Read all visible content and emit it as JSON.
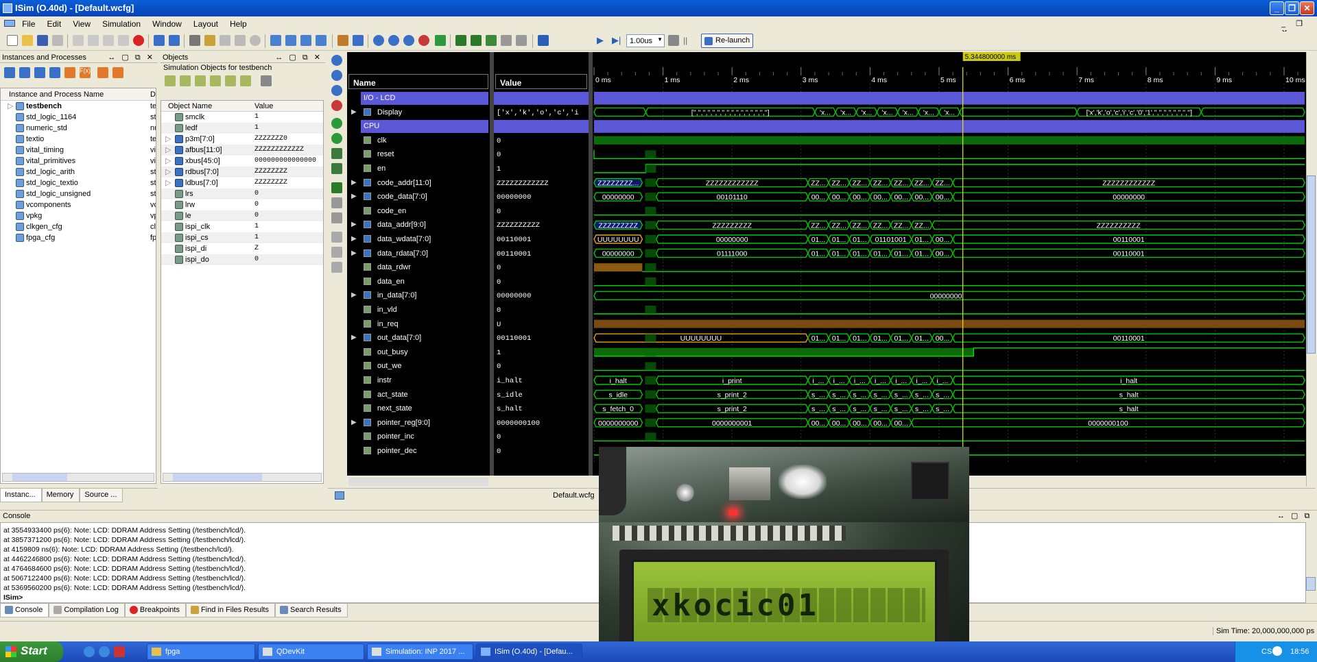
{
  "window": {
    "title": "ISim (O.40d) - [Default.wcfg]"
  },
  "menu": [
    "File",
    "Edit",
    "View",
    "Simulation",
    "Window",
    "Layout",
    "Help"
  ],
  "toolbar": {
    "sim_time": "1.00us",
    "relaunch_label": "Re-launch"
  },
  "instances_panel": {
    "title": "Instances and Processes",
    "col_name": "Instance and Process Name",
    "col_design": "D",
    "items": [
      {
        "name": "testbench",
        "d": "te",
        "bold": true
      },
      {
        "name": "std_logic_1164",
        "d": "st"
      },
      {
        "name": "numeric_std",
        "d": "nu"
      },
      {
        "name": "textio",
        "d": "te"
      },
      {
        "name": "vital_timing",
        "d": "vi"
      },
      {
        "name": "vital_primitives",
        "d": "vi"
      },
      {
        "name": "std_logic_arith",
        "d": "st"
      },
      {
        "name": "std_logic_textio",
        "d": "st"
      },
      {
        "name": "std_logic_unsigned",
        "d": "st"
      },
      {
        "name": "vcomponents",
        "d": "vc"
      },
      {
        "name": "vpkg",
        "d": "vp"
      },
      {
        "name": "clkgen_cfg",
        "d": "cll"
      },
      {
        "name": "fpga_cfg",
        "d": "fp"
      }
    ],
    "tabs": [
      "Instanc...",
      "Memory",
      "Source ..."
    ]
  },
  "objects_panel": {
    "title": "Objects",
    "subtitle": "Simulation Objects for testbench",
    "col_name": "Object Name",
    "col_value": "Value",
    "items": [
      {
        "name": "smclk",
        "value": "1",
        "bus": false
      },
      {
        "name": "ledf",
        "value": "1",
        "bus": false
      },
      {
        "name": "p3m[7:0]",
        "value": "ZZZZZZZ0",
        "bus": true
      },
      {
        "name": "afbus[11:0]",
        "value": "ZZZZZZZZZZZZ",
        "bus": true
      },
      {
        "name": "xbus[45:0]",
        "value": "000000000000000",
        "bus": true
      },
      {
        "name": "rdbus[7:0]",
        "value": "ZZZZZZZZ",
        "bus": true
      },
      {
        "name": "ldbus[7:0]",
        "value": "ZZZZZZZZ",
        "bus": true
      },
      {
        "name": "lrs",
        "value": "0",
        "bus": false
      },
      {
        "name": "lrw",
        "value": "0",
        "bus": false
      },
      {
        "name": "le",
        "value": "0",
        "bus": false
      },
      {
        "name": "ispi_clk",
        "value": "1",
        "bus": false
      },
      {
        "name": "ispi_cs",
        "value": "1",
        "bus": false
      },
      {
        "name": "ispi_di",
        "value": "Z",
        "bus": false
      },
      {
        "name": "ispi_do",
        "value": "0",
        "bus": false
      }
    ]
  },
  "wave": {
    "name_header": "Name",
    "value_header": "Value",
    "cursor_label": "5.344800000 ms",
    "time_ticks": [
      "0 ms",
      "1 ms",
      "2 ms",
      "3 ms",
      "4 ms",
      "5 ms",
      "6 ms",
      "7 ms",
      "8 ms",
      "9 ms",
      "10 ms"
    ],
    "signals": [
      {
        "name": "I/O - LCD",
        "value": "",
        "group": true
      },
      {
        "name": "Display",
        "value": "['x','k','o','c','i",
        "bus": true
      },
      {
        "name": "CPU",
        "value": "",
        "group": true
      },
      {
        "name": "clk",
        "value": "0"
      },
      {
        "name": "reset",
        "value": "0"
      },
      {
        "name": "en",
        "value": "1"
      },
      {
        "name": "code_addr[11:0]",
        "value": "ZZZZZZZZZZZZ",
        "bus": true
      },
      {
        "name": "code_data[7:0]",
        "value": "00000000",
        "bus": true
      },
      {
        "name": "code_en",
        "value": "0"
      },
      {
        "name": "data_addr[9:0]",
        "value": "ZZZZZZZZZZ",
        "bus": true
      },
      {
        "name": "data_wdata[7:0]",
        "value": "00110001",
        "bus": true
      },
      {
        "name": "data_rdata[7:0]",
        "value": "00110001",
        "bus": true
      },
      {
        "name": "data_rdwr",
        "value": "0"
      },
      {
        "name": "data_en",
        "value": "0"
      },
      {
        "name": "in_data[7:0]",
        "value": "00000000",
        "bus": true
      },
      {
        "name": "in_vld",
        "value": "0"
      },
      {
        "name": "in_req",
        "value": "U"
      },
      {
        "name": "out_data[7:0]",
        "value": "00110001",
        "bus": true
      },
      {
        "name": "out_busy",
        "value": "1"
      },
      {
        "name": "out_we",
        "value": "0"
      },
      {
        "name": "instr",
        "value": "i_halt"
      },
      {
        "name": "act_state",
        "value": "s_idle"
      },
      {
        "name": "next_state",
        "value": "s_halt"
      },
      {
        "name": "pointer_reg[9:0]",
        "value": "0000000100",
        "bus": true
      },
      {
        "name": "pointer_inc",
        "value": "0"
      },
      {
        "name": "pointer_dec",
        "value": "0"
      }
    ],
    "labels": {
      "display_a": "['','','','','','','','','','','','','','','','']",
      "display_b": "['x','k','o','c','i','c','0','1','','','','','','','','']",
      "code_addr_a": "ZZZZZZZZ...",
      "code_addr_b": "ZZZZZZZZZZZZ",
      "code_data_a": "00000000",
      "code_data_b": "00101110",
      "data_addr_a": "ZZZZZZZZZ",
      "data_addr_b": "ZZZZZZZZZ",
      "data_addr_c": "ZZZZZZZZZZ",
      "data_wdata_a": "UUUUUUUU",
      "data_wdata_b": "00000000",
      "data_wdata_c": "01101001",
      "data_wdata_d": "00110001",
      "data_rdata_a": "00000000",
      "data_rdata_b": "01111000",
      "data_rdata_c": "00110001",
      "in_data_a": "00000000",
      "out_data_a": "UUUUUUUU",
      "out_data_b": "00110001",
      "instr_a": "i_halt",
      "instr_b": "i_print",
      "act_state_a": "s_idle",
      "act_state_b": "s_print_2",
      "act_state_c": "s_halt",
      "next_state_a": "s_fetch_0",
      "next_state_b": "s_print_2",
      "pointer_a": "0000000000",
      "pointer_b": "0000000001",
      "pointer_c": "0000000100",
      "short_zz": "ZZ...",
      "short_00": "00...",
      "short_01": "01...",
      "short_x": "'x...",
      "short_i": "i_...",
      "short_s": "s_..."
    },
    "tab": "Default.wcfg"
  },
  "console": {
    "title": "Console",
    "lines": [
      "at 3554933400 ps(6): Note: LCD: DDRAM Address Setting (/testbench/lcd/).",
      "at 3857371200 ps(6): Note: LCD: DDRAM Address Setting (/testbench/lcd/).",
      "at 4159809 ns(6): Note: LCD: DDRAM Address Setting (/testbench/lcd/).",
      "at 4462246800 ps(6): Note: LCD: DDRAM Address Setting (/testbench/lcd/).",
      "at 4764684600 ps(6): Note: LCD: DDRAM Address Setting (/testbench/lcd/).",
      "at 5067122400 ps(6): Note: LCD: DDRAM Address Setting (/testbench/lcd/).",
      "at 5369560200 ps(6): Note: LCD: DDRAM Address Setting (/testbench/lcd/)."
    ],
    "prompt": "ISim>",
    "tabs": [
      "Console",
      "Compilation Log",
      "Breakpoints",
      "Find in Files Results",
      "Search Results"
    ]
  },
  "status": {
    "sim_time": "Sim Time: 20,000,000,000 ps"
  },
  "photo": {
    "lcd_text": "xkocic01"
  },
  "taskbar": {
    "start": "Start",
    "tasks": [
      "fpga",
      "QDevKit",
      "Simulation: INP 2017 ...",
      "ISim (O.40d) - [Defau..."
    ],
    "lang": "CS",
    "clock": "18:56"
  },
  "colors": {
    "wave_green": "#00e000",
    "bus_green": "#00c800",
    "cursor": "#e8e800",
    "group": "#5b58d8",
    "titlebar": "#0a5fd8"
  }
}
